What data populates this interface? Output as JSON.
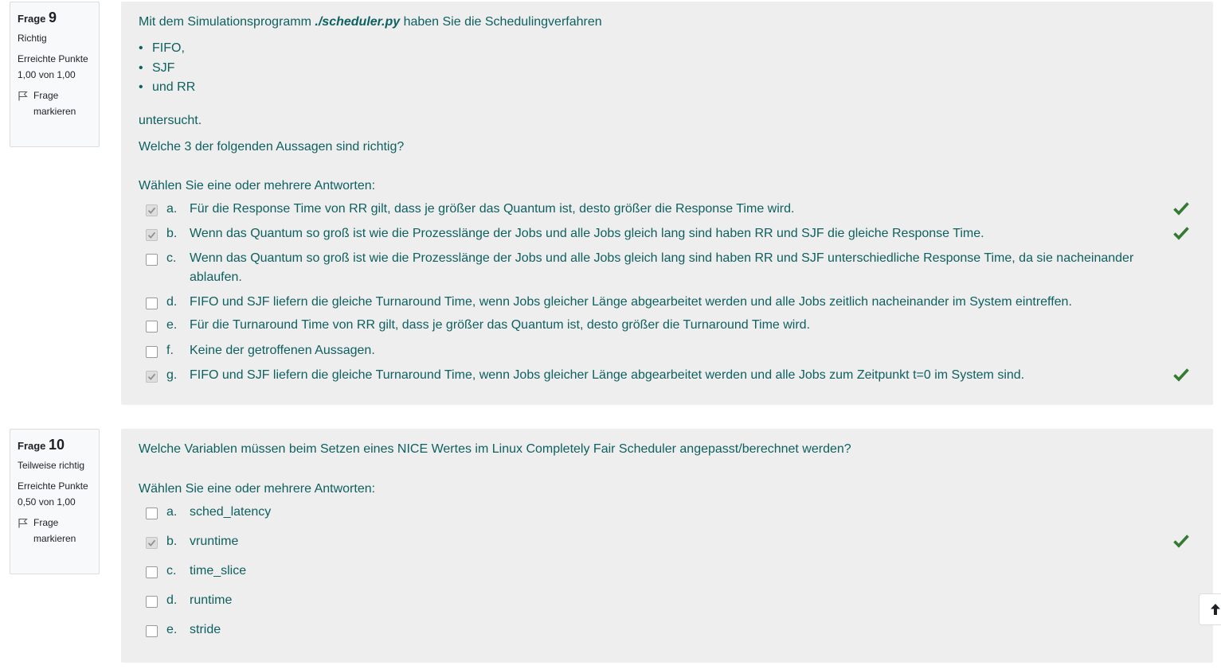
{
  "questions": [
    {
      "frage_label": "Frage",
      "number": "9",
      "state": "Richtig",
      "grade": "Erreichte Punkte 1,00 von 1,00",
      "flag_label": "Frage markieren",
      "text_pre": "Mit dem Simulationsprogramm ",
      "text_file": "./scheduler.py",
      "text_post": " haben Sie die Schedulingverfahren",
      "bullets": [
        "FIFO,",
        "SJF",
        "und RR"
      ],
      "after_list": "untersucht.",
      "question_line": "Welche 3 der folgenden Aussagen sind richtig?",
      "prompt": "Wählen Sie eine oder mehrere Antworten:",
      "answers": [
        {
          "letter": "a.",
          "text": "Für die Response Time von RR gilt, dass je größer das Quantum ist, desto größer die Response Time wird.",
          "checked": true,
          "correct": true
        },
        {
          "letter": "b.",
          "text": "Wenn das Quantum so groß ist wie die Prozesslänge der Jobs und alle Jobs gleich lang sind haben RR und SJF die gleiche Response Time.",
          "checked": true,
          "correct": true
        },
        {
          "letter": "c.",
          "text": "Wenn das Quantum so groß ist wie die Prozesslänge der Jobs und alle Jobs gleich lang sind haben RR und SJF unterschiedliche Response Time, da sie nacheinander ablaufen.",
          "checked": false,
          "correct": false
        },
        {
          "letter": "d.",
          "text": "FIFO und SJF liefern die gleiche Turnaround Time, wenn Jobs gleicher Länge abgearbeitet werden und alle Jobs zeitlich nacheinander im System eintreffen.",
          "checked": false,
          "correct": false
        },
        {
          "letter": "e.",
          "text": "Für die Turnaround Time von RR gilt, dass je größer das Quantum ist, desto größer die Turnaround Time wird.",
          "checked": false,
          "correct": false
        },
        {
          "letter": "f.",
          "text": "Keine der getroffenen Aussagen.",
          "checked": false,
          "correct": false
        },
        {
          "letter": "g.",
          "text": "FIFO und SJF liefern die gleiche Turnaround Time, wenn Jobs gleicher Länge abgearbeitet werden und alle Jobs zum Zeitpunkt t=0 im System sind.",
          "checked": true,
          "correct": true
        }
      ]
    },
    {
      "frage_label": "Frage",
      "number": "10",
      "state": "Teilweise richtig",
      "grade": "Erreichte Punkte 0,50 von 1,00",
      "flag_label": "Frage markieren",
      "question_line": "Welche Variablen müssen beim Setzen eines NICE Wertes im Linux Completely Fair Scheduler angepasst/berechnet werden?",
      "prompt": "Wählen Sie eine oder mehrere Antworten:",
      "answers": [
        {
          "letter": "a.",
          "text": "sched_latency",
          "checked": false,
          "correct": false
        },
        {
          "letter": "b.",
          "text": "vruntime",
          "checked": true,
          "correct": true
        },
        {
          "letter": "c.",
          "text": "time_slice",
          "checked": false,
          "correct": false
        },
        {
          "letter": "d.",
          "text": "runtime",
          "checked": false,
          "correct": false
        },
        {
          "letter": "e.",
          "text": "stride",
          "checked": false,
          "correct": false
        }
      ]
    }
  ],
  "colors": {
    "text": "#0f6060",
    "correct_mark": "#357a32",
    "panel_bg": "#eeeeee",
    "info_bg": "#f8f9fa"
  },
  "icons": {
    "flag": "flag-icon",
    "correct": "check-icon",
    "scroll_top": "arrow-up-icon"
  }
}
